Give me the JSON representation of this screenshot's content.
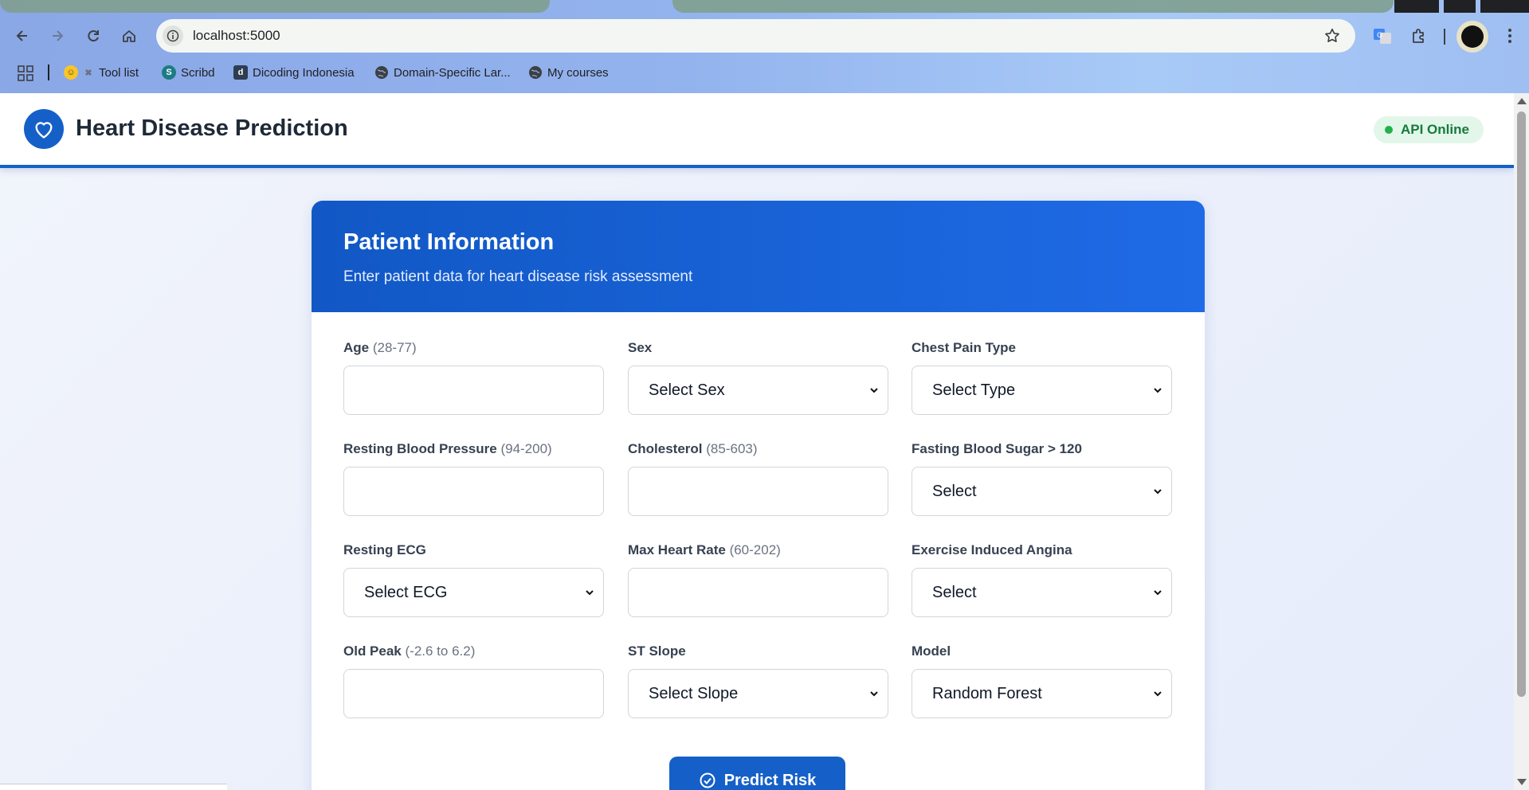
{
  "browser": {
    "url": "localhost:5000",
    "bookmarks": [
      "Tool list",
      "Scribd",
      "Dicoding Indonesia",
      "Domain-Specific Lar...",
      "My courses"
    ]
  },
  "header": {
    "title": "Heart Disease Prediction",
    "status": "API Online"
  },
  "card": {
    "title": "Patient Information",
    "subtitle": "Enter patient data for heart disease risk assessment"
  },
  "fields": {
    "age": {
      "label": "Age",
      "range": "(28-77)"
    },
    "sex": {
      "label": "Sex",
      "value": "Select Sex"
    },
    "chest_pain": {
      "label": "Chest Pain Type",
      "value": "Select Type"
    },
    "resting_bp": {
      "label": "Resting Blood Pressure",
      "range": "(94-200)"
    },
    "cholesterol": {
      "label": "Cholesterol",
      "range": "(85-603)"
    },
    "fasting_bs": {
      "label": "Fasting Blood Sugar > 120",
      "value": "Select"
    },
    "resting_ecg": {
      "label": "Resting ECG",
      "value": "Select ECG"
    },
    "max_hr": {
      "label": "Max Heart Rate",
      "range": "(60-202)"
    },
    "exercise_angina": {
      "label": "Exercise Induced Angina",
      "value": "Select"
    },
    "old_peak": {
      "label": "Old Peak",
      "range": "(-2.6 to 6.2)"
    },
    "st_slope": {
      "label": "ST Slope",
      "value": "Select Slope"
    },
    "model": {
      "label": "Model",
      "value": "Random Forest"
    }
  },
  "predict_label": "Predict Risk",
  "colors": {
    "primary": "#1560c8",
    "status_green": "#22b14c"
  }
}
